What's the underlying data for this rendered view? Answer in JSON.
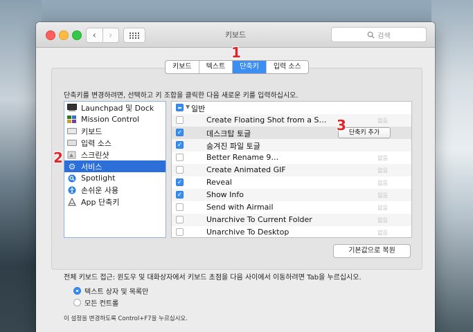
{
  "window": {
    "title": "키보드",
    "search_placeholder": "검색"
  },
  "tabs": [
    {
      "label": "키보드",
      "selected": false
    },
    {
      "label": "텍스트",
      "selected": false
    },
    {
      "label": "단축키",
      "selected": true
    },
    {
      "label": "입력 소스",
      "selected": false
    }
  ],
  "instruction": "단축키를 변경하려면, 선택하고 키 조합을 클릭한 다음 새로운 키를 입력하십시오.",
  "categories": [
    {
      "label": "Launchpad 및 Dock",
      "icon": "launchpad-icon"
    },
    {
      "label": "Mission Control",
      "icon": "mission-control-icon"
    },
    {
      "label": "키보드",
      "icon": "keyboard-icon"
    },
    {
      "label": "입력 소스",
      "icon": "input-source-icon"
    },
    {
      "label": "스크린샷",
      "icon": "screenshot-icon"
    },
    {
      "label": "서비스",
      "icon": "gear-icon",
      "selected": true
    },
    {
      "label": "Spotlight",
      "icon": "spotlight-icon"
    },
    {
      "label": "손쉬운 사용",
      "icon": "accessibility-icon"
    },
    {
      "label": "App 단축키",
      "icon": "app-shortcuts-icon"
    }
  ],
  "shortcuts": {
    "group_label": "일반",
    "add_button": "단축키 추가",
    "none_label": "없음",
    "rows": [
      {
        "label": "Create Floating Shot from a S…",
        "checked": false
      },
      {
        "label": "데스크탑 토글",
        "checked": true
      },
      {
        "label": "숨겨진 파일 토글",
        "checked": true
      },
      {
        "label": "Better Rename 9…",
        "checked": false
      },
      {
        "label": "Create Animated GIF",
        "checked": false
      },
      {
        "label": "Reveal",
        "checked": true
      },
      {
        "label": "Show Info",
        "checked": true
      },
      {
        "label": "Send with Airmail",
        "checked": false
      },
      {
        "label": "Unarchive To Current Folder",
        "checked": false
      },
      {
        "label": "Unarchive To Desktop",
        "checked": false
      }
    ]
  },
  "restore_button": "기본값으로 복원",
  "full_keyboard_access": {
    "label": "전체 키보드 접근: 윈도우 및 대화상자에서 키보드 초점을 다음 사이에서 이동하려면 Tab을 누르십시오.",
    "options": [
      {
        "label": "텍스트 상자 및 목록만",
        "selected": true
      },
      {
        "label": "모든 컨트롤",
        "selected": false
      }
    ],
    "hint": "이 설정을 변경하도록 Control+F7을 누르십시오."
  },
  "annotations": [
    "1",
    "2",
    "3"
  ]
}
